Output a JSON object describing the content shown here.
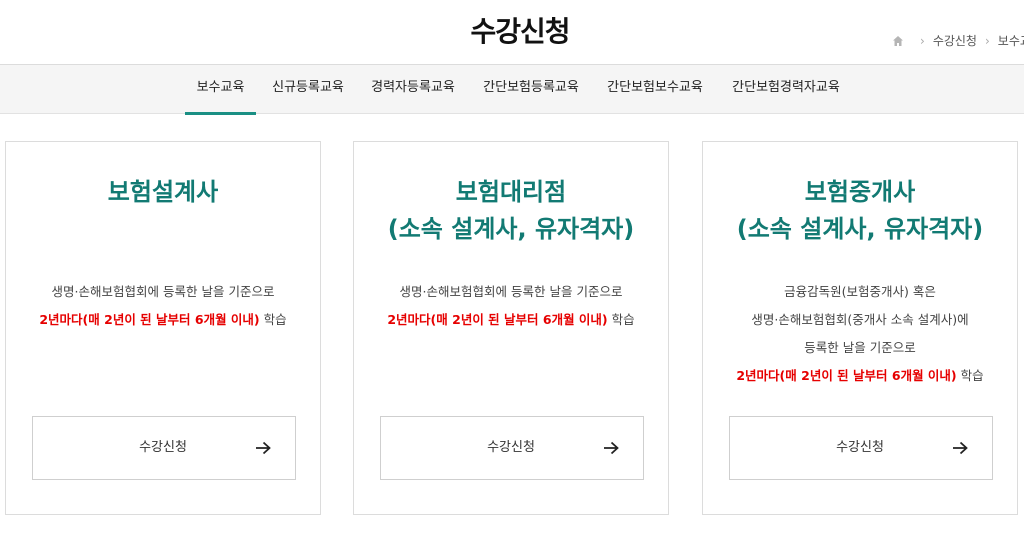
{
  "header": {
    "title": "수강신청",
    "breadcrumb": [
      "수강신청",
      "보수교"
    ]
  },
  "tabs": [
    {
      "label": "보수교육",
      "active": true
    },
    {
      "label": "신규등록교육",
      "active": false
    },
    {
      "label": "경력자등록교육",
      "active": false
    },
    {
      "label": "간단보험등록교육",
      "active": false
    },
    {
      "label": "간단보험보수교육",
      "active": false
    },
    {
      "label": "간단보험경력자교육",
      "active": false
    }
  ],
  "cards": [
    {
      "title_lines": [
        "보험설계사"
      ],
      "desc_lines": [
        "생명·손해보험협회에 등록한 날을 기준으로"
      ],
      "highlight": "2년마다(매 2년이 된 날부터 6개월 이내)",
      "suffix": " 학습",
      "button_label": "수강신청"
    },
    {
      "title_lines": [
        "보험대리점",
        "(소속 설계사, 유자격자)"
      ],
      "desc_lines": [
        "생명·손해보험협회에 등록한 날을 기준으로"
      ],
      "highlight": "2년마다(매 2년이 된 날부터 6개월 이내)",
      "suffix": " 학습",
      "button_label": "수강신청"
    },
    {
      "title_lines": [
        "보험중개사",
        "(소속 설계사, 유자격자)"
      ],
      "desc_lines": [
        "금융감독원(보험중개사) 혹은",
        "생명·손해보험협회(중개사 소속 설계사)에",
        "등록한 날을 기준으로"
      ],
      "highlight": "2년마다(매 2년이 된 날부터 6개월 이내)",
      "suffix": " 학습",
      "button_label": "수강신청"
    }
  ],
  "colors": {
    "accent": "#127a73",
    "tab_underline": "#1a8f84",
    "highlight": "#e60000"
  },
  "icons": {
    "home": "home-icon",
    "separator": "chevron-right-icon",
    "button_arrow": "arrow-right-icon"
  }
}
